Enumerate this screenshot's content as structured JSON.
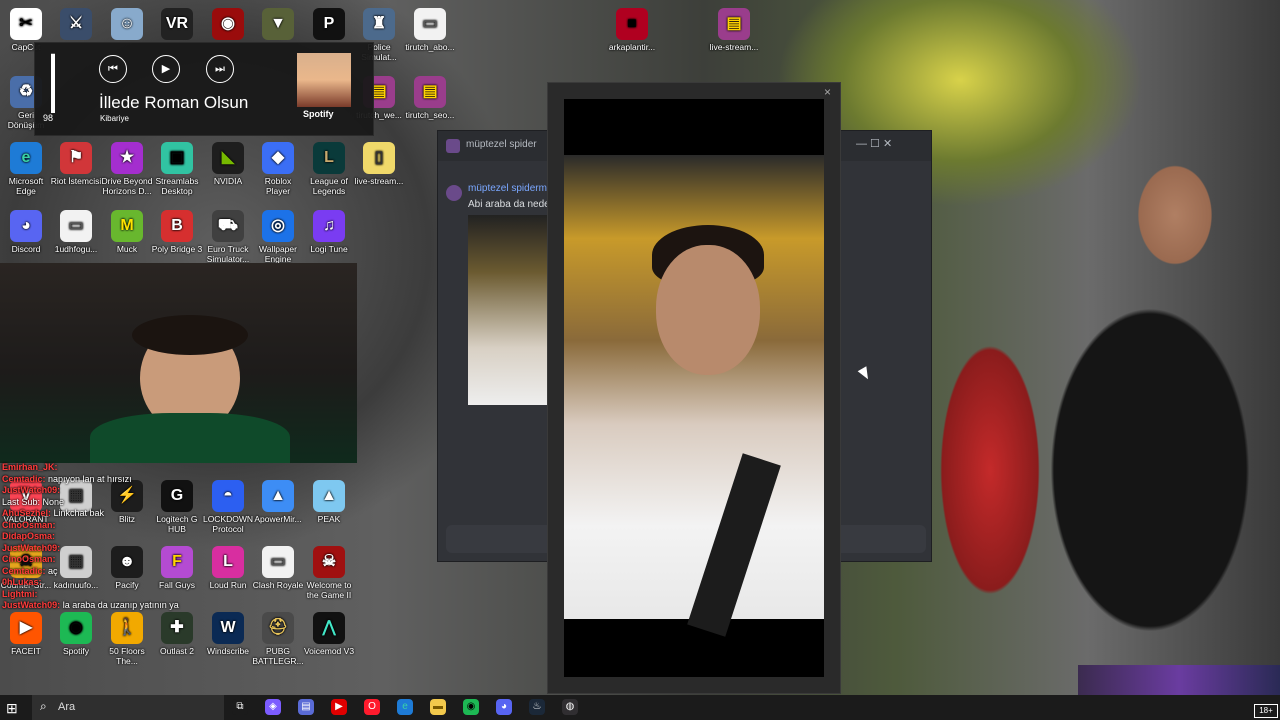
{
  "desktop_icons": [
    {
      "label": "CapCut",
      "glyph": "✂",
      "bg": "#ffffff",
      "fg": "#000000"
    },
    {
      "label": "",
      "glyph": "⚔",
      "bg": "#3a4d6a",
      "fg": "#ffffff"
    },
    {
      "label": "",
      "glyph": "☺",
      "bg": "#88aacc",
      "fg": "#ffffff"
    },
    {
      "label": "",
      "glyph": "VR",
      "bg": "#222222",
      "fg": "#ffffff"
    },
    {
      "label": "",
      "glyph": "◉",
      "bg": "#9a0c0c",
      "fg": "#ffffff"
    },
    {
      "label": "",
      "glyph": "▼",
      "bg": "#586138",
      "fg": "#ffffff"
    },
    {
      "label": "",
      "glyph": "P",
      "bg": "#111111",
      "fg": "#ffffff"
    },
    {
      "label": "Police Simulat...",
      "glyph": "♜",
      "bg": "#4c6a8c",
      "fg": "#ffffff"
    },
    {
      "label": "tirutch_abo...",
      "glyph": "▭",
      "bg": "#f2f2f2",
      "fg": "#555555"
    },
    {
      "label": "arkaplantir...",
      "glyph": "■",
      "bg": "#b00020",
      "fg": "#000000"
    },
    {
      "label": "live-stream...",
      "glyph": "▤",
      "bg": "#9a3d8c",
      "fg": "#ffd400"
    },
    {
      "label": "Geri Dönüşüm",
      "glyph": "♻",
      "bg": "#4a6ea9",
      "fg": "#ffffff"
    },
    {
      "label": "tirutch_we...",
      "glyph": "▤",
      "bg": "#9a3d8c",
      "fg": "#ffd400"
    },
    {
      "label": "tirutch_seo...",
      "glyph": "▤",
      "bg": "#9a3d8c",
      "fg": "#ffd400"
    },
    {
      "label": "Microsoft Edge",
      "glyph": "e",
      "bg": "#1e7bd6",
      "fg": "#39d2a7"
    },
    {
      "label": "Riot İstemcisi",
      "glyph": "⚑",
      "bg": "#d13639",
      "fg": "#ffffff"
    },
    {
      "label": "Drive Beyond Horizons D...",
      "glyph": "★",
      "bg": "#a42ecf",
      "fg": "#ffffff"
    },
    {
      "label": "Streamlabs Desktop",
      "glyph": "▣",
      "bg": "#31c3a2",
      "fg": "#000000"
    },
    {
      "label": "NVIDIA",
      "glyph": "◣",
      "bg": "#1e1e1e",
      "fg": "#76b900"
    },
    {
      "label": "Roblox Player",
      "glyph": "◆",
      "bg": "#3b6ef5",
      "fg": "#ffffff"
    },
    {
      "label": "League of Legends",
      "glyph": "L",
      "bg": "#0a3a3a",
      "fg": "#c8aa6e"
    },
    {
      "label": "live-stream...",
      "glyph": "▯",
      "bg": "#f0d96a",
      "fg": "#333333"
    },
    {
      "label": "Discord",
      "glyph": "◕",
      "bg": "#5865f2",
      "fg": "#ffffff"
    },
    {
      "label": "1udhfogu...",
      "glyph": "▭",
      "bg": "#f2f2f2",
      "fg": "#555555"
    },
    {
      "label": "Muck",
      "glyph": "M",
      "bg": "#68b72e",
      "fg": "#ffe400"
    },
    {
      "label": "Poly Bridge 3",
      "glyph": "B",
      "bg": "#d62f2f",
      "fg": "#ffffff"
    },
    {
      "label": "Euro Truck Simulator...",
      "glyph": "⛟",
      "bg": "#404040",
      "fg": "#ffffff"
    },
    {
      "label": "Wallpaper Engine",
      "glyph": "◎",
      "bg": "#1c72e8",
      "fg": "#ffffff"
    },
    {
      "label": "Logi Tune",
      "glyph": "♫",
      "bg": "#7a3cf2",
      "fg": "#ffffff"
    },
    {
      "label": "VALORANT",
      "glyph": "V",
      "bg": "#fa4454",
      "fg": "#ffffff"
    },
    {
      "label": "",
      "glyph": "▦",
      "bg": "#cfcfcf",
      "fg": "#333333"
    },
    {
      "label": "Blitz",
      "glyph": "⚡",
      "bg": "#1d1d1d",
      "fg": "#ff3c3c"
    },
    {
      "label": "Logitech G HUB",
      "glyph": "G",
      "bg": "#111111",
      "fg": "#ffffff"
    },
    {
      "label": "LOCKDOWN Protocol",
      "glyph": "◓",
      "bg": "#2c5ff1",
      "fg": "#ffffff"
    },
    {
      "label": "ApowerMir...",
      "glyph": "▲",
      "bg": "#3d8df5",
      "fg": "#ffffff"
    },
    {
      "label": "PEAK",
      "glyph": "▲",
      "bg": "#7ec8f0",
      "fg": "#ffffff"
    },
    {
      "label": "Counter-Str...",
      "glyph": "☠",
      "bg": "#e5a51d",
      "fg": "#111111"
    },
    {
      "label": "kadınuufo...",
      "glyph": "▦",
      "bg": "#cfcfcf",
      "fg": "#333333"
    },
    {
      "label": "Pacify",
      "glyph": "☻",
      "bg": "#1d1d1d",
      "fg": "#ffffff"
    },
    {
      "label": "Fall Guys",
      "glyph": "F",
      "bg": "#b44bd2",
      "fg": "#ffd400"
    },
    {
      "label": "Loud Run",
      "glyph": "L",
      "bg": "#d82ea0",
      "fg": "#ffffff"
    },
    {
      "label": "Clash Royale",
      "glyph": "▭",
      "bg": "#f2f2f2",
      "fg": "#555555"
    },
    {
      "label": "Welcome to the Game II",
      "glyph": "☠",
      "bg": "#a01010",
      "fg": "#ffffff"
    },
    {
      "label": "FACEIT",
      "glyph": "▶",
      "bg": "#ff5500",
      "fg": "#ffffff"
    },
    {
      "label": "Spotify",
      "glyph": "◉",
      "bg": "#1db954",
      "fg": "#000000"
    },
    {
      "label": "50 Floors The...",
      "glyph": "🚶",
      "bg": "#f2a900",
      "fg": "#000000"
    },
    {
      "label": "Outlast 2",
      "glyph": "✚",
      "bg": "#2a3a2a",
      "fg": "#ffffff"
    },
    {
      "label": "Windscribe",
      "glyph": "W",
      "bg": "#0b2a54",
      "fg": "#ffffff"
    },
    {
      "label": "PUBG BATTLEGR...",
      "glyph": "⛑",
      "bg": "#4a4a4a",
      "fg": "#e8c45a"
    },
    {
      "label": "Voicemod V3",
      "glyph": "⋀",
      "bg": "#111111",
      "fg": "#42e8c8"
    }
  ],
  "media_overlay": {
    "volume": 98,
    "volume_label": "98",
    "prev_glyph": "⏮",
    "play_glyph": "▶",
    "next_glyph": "⏭",
    "track": "İllede Roman Olsun",
    "artist": "Kibariye",
    "source": "Spotify"
  },
  "chat_messages": [
    {
      "user": "Emirhan_JK:",
      "text": ""
    },
    {
      "user": "Cemtadic:",
      "text": "napıyon lan at hırsızı"
    },
    {
      "user": "JustWatch09:",
      "text": ""
    },
    {
      "user": "",
      "text": "Last Sub: None"
    },
    {
      "user": "AhuSezhel:",
      "text": "Linkchat bak"
    },
    {
      "user": "CinoOsman:",
      "text": ""
    },
    {
      "user": "DidapOsma:",
      "text": ""
    },
    {
      "user": "JustWatch09:",
      "text": ""
    },
    {
      "user": "CinoOsman:",
      "text": ""
    },
    {
      "user": "Cemtadic:",
      "text": "aç"
    },
    {
      "user": "0hLukas:",
      "text": ""
    },
    {
      "user": "Lightmi:",
      "text": ""
    },
    {
      "user": "JustWatch09:",
      "text": "la araba da uzanıp yatının ya"
    }
  ],
  "discord": {
    "tab_name": "müptezel spider",
    "message_author": "müptezel spiderma",
    "message_text": "Abi araba da nede",
    "window_controls": "—  ☐  ✕"
  },
  "video_popup": {
    "close": "×"
  },
  "taskbar": {
    "start_glyph": "⊞",
    "search_icon": "⌕",
    "search_placeholder": "Ara",
    "apps": [
      {
        "name": "task-view",
        "glyph": "⧉",
        "bg": "#1b1b1b",
        "fg": "#ffffff"
      },
      {
        "name": "copilot",
        "glyph": "◈",
        "bg": "#7c5cff",
        "fg": "#ffffff"
      },
      {
        "name": "media",
        "glyph": "▤",
        "bg": "#5a6bd6",
        "fg": "#ffffff"
      },
      {
        "name": "youtube",
        "glyph": "▶",
        "bg": "#e00000",
        "fg": "#ffffff"
      },
      {
        "name": "opera",
        "glyph": "O",
        "bg": "#ff1b2d",
        "fg": "#ffffff"
      },
      {
        "name": "edge",
        "glyph": "e",
        "bg": "#1e7bd6",
        "fg": "#39d2a7"
      },
      {
        "name": "file-explorer",
        "glyph": "▬",
        "bg": "#f2c94c",
        "fg": "#7a5a00"
      },
      {
        "name": "spotify",
        "glyph": "◉",
        "bg": "#1db954",
        "fg": "#000000"
      },
      {
        "name": "discord",
        "glyph": "◕",
        "bg": "#5865f2",
        "fg": "#ffffff"
      },
      {
        "name": "steam",
        "glyph": "♨",
        "bg": "#1b2838",
        "fg": "#ffffff"
      },
      {
        "name": "obs",
        "glyph": "◍",
        "bg": "#302e31",
        "fg": "#ffffff"
      }
    ],
    "age_badge": "18+"
  }
}
